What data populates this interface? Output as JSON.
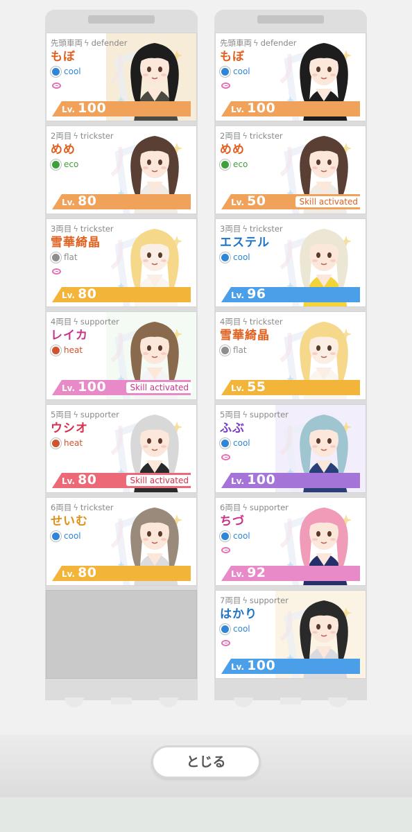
{
  "left_train": [
    {
      "position": "先頭車両",
      "role": "defender",
      "name": "もぼ",
      "name_color": "#e06020",
      "attribute": "cool",
      "attr_color": "#2f86d6",
      "show_ring": true,
      "level_label": "Lv.",
      "level": "100",
      "bar_color": "#f0a25a",
      "skill_text": "",
      "art": {
        "hair": "#1d1d1d",
        "skin": "#fbe8da",
        "outfit": "#4a4a42",
        "bg": "#f7ecd8"
      }
    },
    {
      "position": "2両目",
      "role": "trickster",
      "name": "めめ",
      "name_color": "#e06020",
      "attribute": "eco",
      "attr_color": "#3fa03a",
      "show_ring": false,
      "level_label": "Lv.",
      "level": "80",
      "bar_color": "#f0a25a",
      "skill_text": "",
      "art": {
        "hair": "#5a4034",
        "skin": "#fbe8da",
        "outfit": "#f0ebe4",
        "bg": "#ffffff"
      }
    },
    {
      "position": "3両目",
      "role": "trickster",
      "name": "雪華綺晶",
      "name_color": "#e06020",
      "attribute": "flat",
      "attr_color": "#8e8e8e",
      "show_ring": true,
      "level_label": "Lv.",
      "level": "80",
      "bar_color": "#f3b43a",
      "skill_text": "",
      "art": {
        "hair": "#f6d88a",
        "skin": "#fbeee4",
        "outfit": "#faf6ef",
        "bg": "#ffffff"
      }
    },
    {
      "position": "4両目",
      "role": "supporter",
      "name": "レイカ",
      "name_color": "#c9338a",
      "attribute": "heat",
      "attr_color": "#d0522e",
      "show_ring": false,
      "level_label": "Lv.",
      "level": "100",
      "bar_color": "#e889c8",
      "skill_text": "Skill activated",
      "skill_color": "#c9338a",
      "art": {
        "hair": "#8a6a4c",
        "skin": "#fbe8da",
        "outfit": "#f4f4f4",
        "bg": "#f4fbf4"
      }
    },
    {
      "position": "5両目",
      "role": "supporter",
      "name": "ウシオ",
      "name_color": "#d6304a",
      "attribute": "heat",
      "attr_color": "#d0522e",
      "show_ring": false,
      "level_label": "Lv.",
      "level": "80",
      "bar_color": "#ec6a78",
      "skill_text": "Skill activated",
      "skill_color": "#d6304a",
      "art": {
        "hair": "#d8d8d8",
        "skin": "#fbe8da",
        "outfit": "#2a2a2a",
        "bg": "#ffffff"
      }
    },
    {
      "position": "6両目",
      "role": "trickster",
      "name": "せいむ",
      "name_color": "#e09018",
      "attribute": "cool",
      "attr_color": "#2f86d6",
      "show_ring": false,
      "level_label": "Lv.",
      "level": "80",
      "bar_color": "#f3b43a",
      "skill_text": "",
      "art": {
        "hair": "#9a8a7c",
        "skin": "#fbe8da",
        "outfit": "#dcdcdc",
        "bg": "#ffffff"
      }
    }
  ],
  "right_train": [
    {
      "position": "先頭車両",
      "role": "defender",
      "name": "もぼ",
      "name_color": "#e06020",
      "attribute": "cool",
      "attr_color": "#2f86d6",
      "show_ring": true,
      "level_label": "Lv.",
      "level": "100",
      "bar_color": "#f0a25a",
      "skill_text": "",
      "art": {
        "hair": "#1d1d1d",
        "skin": "#fbe8da",
        "outfit": "#1e1e1e",
        "bg": "#ffffff"
      }
    },
    {
      "position": "2両目",
      "role": "trickster",
      "name": "めめ",
      "name_color": "#e06020",
      "attribute": "eco",
      "attr_color": "#3fa03a",
      "show_ring": false,
      "level_label": "Lv.",
      "level": "50",
      "bar_color": "#f0a25a",
      "skill_text": "Skill activated",
      "skill_color": "#e06020",
      "art": {
        "hair": "#5a4034",
        "skin": "#fbe8da",
        "outfit": "#f0ebe4",
        "bg": "#ffffff"
      }
    },
    {
      "position": "3両目",
      "role": "trickster",
      "name": "エステル",
      "name_color": "#1f74c8",
      "attribute": "cool",
      "attr_color": "#2f86d6",
      "show_ring": false,
      "level_label": "Lv.",
      "level": "96",
      "bar_color": "#4b9ee8",
      "skill_text": "",
      "art": {
        "hair": "#ece6d4",
        "skin": "#fbe8da",
        "outfit": "#f2d43a",
        "bg": "#ffffff"
      }
    },
    {
      "position": "4両目",
      "role": "trickster",
      "name": "雪華綺晶",
      "name_color": "#e06020",
      "attribute": "flat",
      "attr_color": "#8e8e8e",
      "show_ring": false,
      "level_label": "Lv.",
      "level": "55",
      "bar_color": "#f3b43a",
      "skill_text": "",
      "art": {
        "hair": "#f6d88a",
        "skin": "#fbeee4",
        "outfit": "#faf6ef",
        "bg": "#ffffff"
      }
    },
    {
      "position": "5両目",
      "role": "supporter",
      "name": "ふぶ",
      "name_color": "#7a3cc4",
      "attribute": "cool",
      "attr_color": "#2f86d6",
      "show_ring": true,
      "level_label": "Lv.",
      "level": "100",
      "bar_color": "#a574d8",
      "skill_text": "",
      "art": {
        "hair": "#9fc6d0",
        "skin": "#fbe8da",
        "outfit": "#2a3f78",
        "bg": "#f3eefb"
      }
    },
    {
      "position": "6両目",
      "role": "supporter",
      "name": "ちづ",
      "name_color": "#c9338a",
      "attribute": "cool",
      "attr_color": "#2f86d6",
      "show_ring": true,
      "level_label": "Lv.",
      "level": "92",
      "bar_color": "#e889c8",
      "skill_text": "",
      "art": {
        "hair": "#f09bb8",
        "skin": "#fbe8da",
        "outfit": "#25306a",
        "bg": "#ffffff"
      }
    },
    {
      "position": "7両目",
      "role": "supporter",
      "name": "はかり",
      "name_color": "#1f74c8",
      "attribute": "cool",
      "attr_color": "#2f86d6",
      "show_ring": true,
      "level_label": "Lv.",
      "level": "100",
      "bar_color": "#4b9ee8",
      "skill_text": "",
      "art": {
        "hair": "#2a2a2a",
        "skin": "#fbe8da",
        "outfit": "#d9d9e0",
        "bg": "#fbf4e4"
      }
    }
  ],
  "close_button_label": "とじる",
  "icons": {
    "role_icon": "lightning-bolt-icon",
    "attribute_icon": "attribute-orb-icon",
    "ring_icon": "ring-icon"
  }
}
